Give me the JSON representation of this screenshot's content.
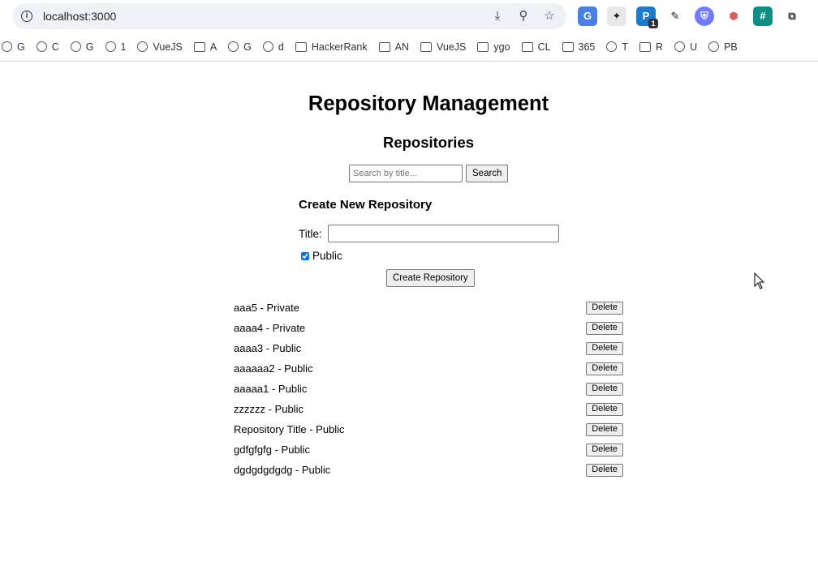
{
  "browser": {
    "url": "localhost:3000",
    "extension_badge": "1",
    "bookmarks": [
      {
        "label": "G",
        "icon": "gemini-icon"
      },
      {
        "label": "C",
        "icon": "claude-icon"
      },
      {
        "label": "G",
        "icon": "openai-icon"
      },
      {
        "label": "1",
        "icon": "openai-icon"
      },
      {
        "label": "VueJS",
        "icon": "openai-icon"
      },
      {
        "label": "A",
        "icon": "folder-icon"
      },
      {
        "label": "G",
        "icon": "github-icon"
      },
      {
        "label": "d",
        "icon": "devtools-icon"
      },
      {
        "label": "HackerRank",
        "icon": "folder-icon"
      },
      {
        "label": "AN",
        "icon": "folder-icon"
      },
      {
        "label": "VueJS",
        "icon": "folder-icon"
      },
      {
        "label": "ygo",
        "icon": "folder-icon"
      },
      {
        "label": "CL",
        "icon": "folder-icon"
      },
      {
        "label": "365",
        "icon": "folder-icon"
      },
      {
        "label": "T",
        "icon": "onedrive-icon"
      },
      {
        "label": "R",
        "icon": "folder-icon"
      },
      {
        "label": "U",
        "icon": "extension-icon"
      },
      {
        "label": "PB",
        "icon": "calculator-icon"
      }
    ]
  },
  "page": {
    "title": "Repository Management",
    "subtitle": "Repositories",
    "search": {
      "placeholder": "Search by title...",
      "button_label": "Search"
    },
    "create": {
      "heading": "Create New Repository",
      "title_label": "Title:",
      "title_value": "",
      "public_label": "Public",
      "public_checked": true,
      "button_label": "Create Repository"
    },
    "repositories": [
      {
        "text": "aaa5 - Private",
        "delete_label": "Delete"
      },
      {
        "text": "aaaa4 - Private",
        "delete_label": "Delete"
      },
      {
        "text": "aaaa3 - Public",
        "delete_label": "Delete"
      },
      {
        "text": "aaaaaa2 - Public",
        "delete_label": "Delete"
      },
      {
        "text": "aaaaa1 - Public",
        "delete_label": "Delete"
      },
      {
        "text": "zzzzzz - Public",
        "delete_label": "Delete"
      },
      {
        "text": "Repository Title - Public",
        "delete_label": "Delete"
      },
      {
        "text": "gdfgfgfg - Public",
        "delete_label": "Delete"
      },
      {
        "text": "dgdgdgdgdg - Public",
        "delete_label": "Delete"
      }
    ]
  }
}
